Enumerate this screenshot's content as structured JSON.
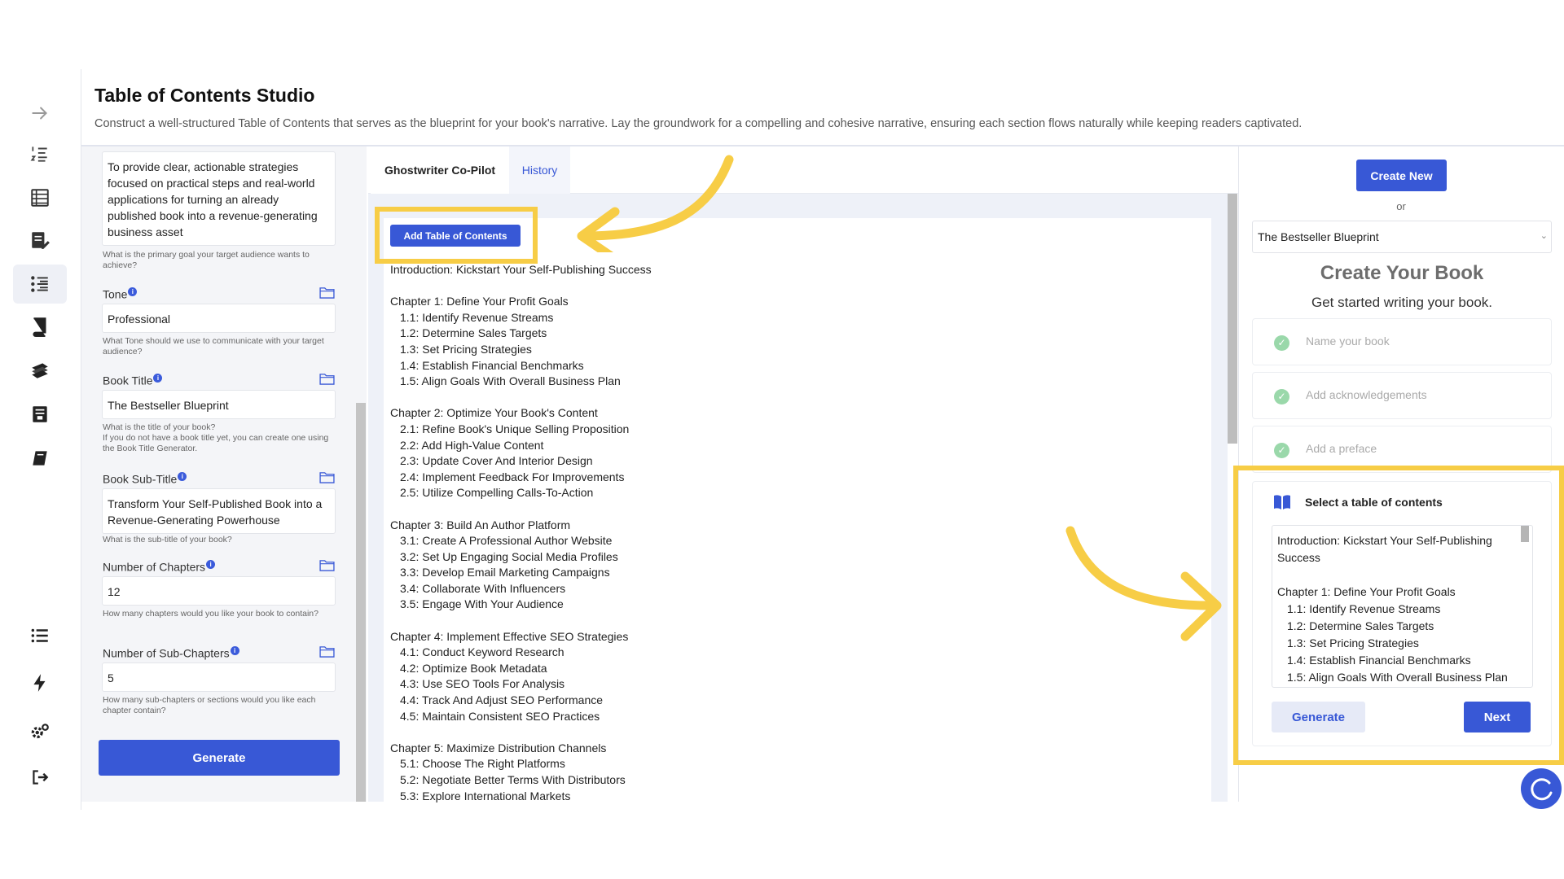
{
  "header": {
    "title": "Table of Contents Studio",
    "description": "Construct a well-structured Table of Contents that serves as the blueprint for your book's narrative. Lay the groundwork for a compelling and cohesive narrative, ensuring each section flows naturally while keeping readers captivated."
  },
  "sidebar": {
    "icons": [
      "arrow-right-icon",
      "numbered-list-icon",
      "table-icon",
      "edit-document-icon",
      "outline-icon",
      "book-icon",
      "books-stack-icon",
      "archive-icon",
      "notebook-icon",
      "list-icon",
      "lightning-icon",
      "settings-icon",
      "logout-icon"
    ]
  },
  "form": {
    "goal_value": "To provide clear, actionable strategies focused on practical steps and real-world applications for turning an already published book into a revenue-generating business asset",
    "goal_help": "What is the primary goal your target audience wants to achieve?",
    "tone_label": "Tone",
    "tone_value": "Professional",
    "tone_help": "What Tone should we use to communicate with your target audience?",
    "title_label": "Book Title",
    "title_value": "The Bestseller Blueprint",
    "title_help": "What is the title of your book?\nIf you do not have a book title yet, you can create one using the Book Title Generator.",
    "subtitle_label": "Book Sub-Title",
    "subtitle_value": "Transform Your Self-Published Book into a Revenue-Generating Powerhouse",
    "subtitle_help": "What is the sub-title of your book?",
    "chapters_label": "Number of Chapters",
    "chapters_value": "12",
    "chapters_help": "How many chapters would you like your book to contain?",
    "subchapters_label": "Number of Sub-Chapters",
    "subchapters_value": "5",
    "subchapters_help": "How many sub-chapters or sections would you like each chapter contain?",
    "generate_label": "Generate"
  },
  "tabs": {
    "copilot": "Ghostwriter Co-Pilot",
    "history": "History"
  },
  "copilot": {
    "add_toc_label": "Add Table of Contents",
    "intro": "Introduction: Kickstart Your Self-Publishing Success",
    "chapters": [
      {
        "title": "Chapter 1: Define Your Profit Goals",
        "subs": [
          "1.1: Identify Revenue Streams",
          "1.2: Determine Sales Targets",
          "1.3: Set Pricing Strategies",
          "1.4: Establish Financial Benchmarks",
          "1.5: Align Goals With Overall Business Plan"
        ]
      },
      {
        "title": "Chapter 2: Optimize Your Book's Content",
        "subs": [
          "2.1: Refine Book's Unique Selling Proposition",
          "2.2: Add High-Value Content",
          "2.3: Update Cover And Interior Design",
          "2.4: Implement Feedback For Improvements",
          "2.5: Utilize Compelling Calls-To-Action"
        ]
      },
      {
        "title": "Chapter 3: Build An Author Platform",
        "subs": [
          "3.1: Create A Professional Author Website",
          "3.2: Set Up Engaging Social Media Profiles",
          "3.3: Develop Email Marketing Campaigns",
          "3.4: Collaborate With Influencers",
          "3.5: Engage With Your Audience"
        ]
      },
      {
        "title": "Chapter 4: Implement Effective SEO Strategies",
        "subs": [
          "4.1: Conduct Keyword Research",
          "4.2: Optimize Book Metadata",
          "4.3: Use SEO Tools For Analysis",
          "4.4: Track And Adjust SEO Performance",
          "4.5: Maintain Consistent SEO Practices"
        ]
      },
      {
        "title": "Chapter 5: Maximize Distribution Channels",
        "subs": [
          "5.1: Choose The Right Platforms",
          "5.2: Negotiate Better Terms With Distributors",
          "5.3: Explore International Markets"
        ]
      }
    ]
  },
  "right_panel": {
    "create_new_label": "Create New",
    "or_text": "or",
    "selected_book": "The Bestseller Blueprint",
    "create_title": "Create Your Book",
    "create_subtitle": "Get started writing your book.",
    "steps": [
      "Name your book",
      "Add acknowledgements",
      "Add a preface"
    ],
    "toc_card_title": "Select a table of contents",
    "toc_intro": "Introduction: Kickstart Your Self-Publishing Success",
    "toc_chapter": "Chapter 1: Define Your Profit Goals",
    "toc_subs": [
      "1.1: Identify Revenue Streams",
      "1.2: Determine Sales Targets",
      "1.3: Set Pricing Strategies",
      "1.4: Establish Financial Benchmarks",
      "1.5: Align Goals With Overall Business Plan"
    ],
    "generate_label": "Generate",
    "next_label": "Next"
  },
  "colors": {
    "accent": "#3858d6",
    "highlight": "#f7cd46",
    "success": "#9ad8aa"
  }
}
